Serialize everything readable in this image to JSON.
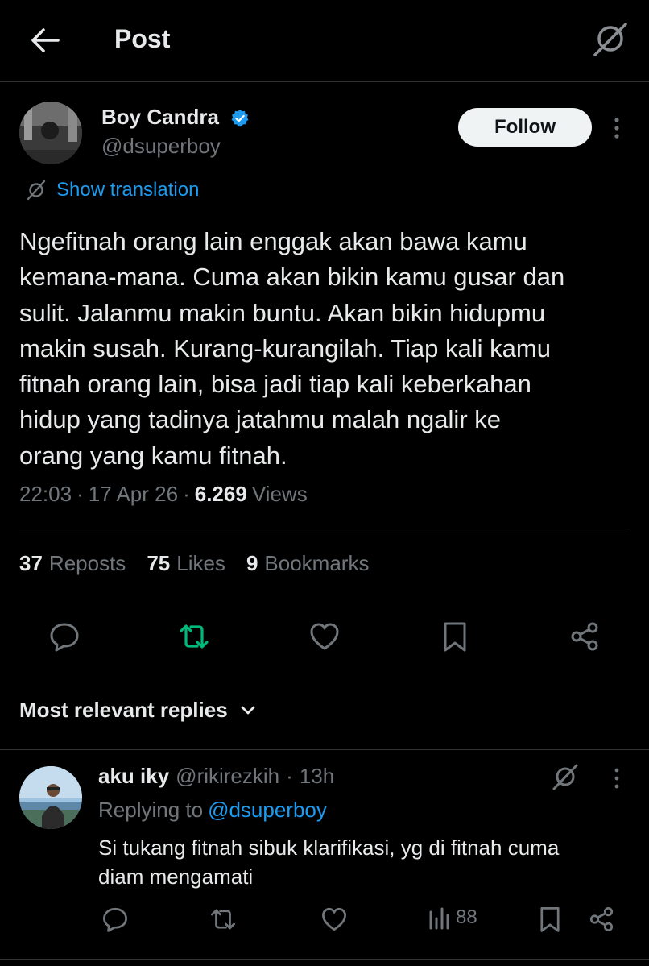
{
  "header": {
    "title": "Post"
  },
  "author": {
    "name": "Boy Candra",
    "handle": "@dsuperboy",
    "verified": true,
    "follow_label": "Follow"
  },
  "translation": {
    "label": "Show translation"
  },
  "post": {
    "text": "Ngefitnah orang lain enggak akan bawa kamu\nkemana-mana. Cuma akan bikin kamu gusar dan\nsulit. Jalanmu makin buntu. Akan bikin hidupmu\nmakin susah. Kurang-kurangilah. Tiap kali kamu\nfitnah orang lain, bisa jadi tiap kali keberkahan\nhidup yang tadinya jatahmu malah ngalir ke\norang yang kamu fitnah.",
    "time": "22:03",
    "date": "17 Apr 26",
    "views_count": "6.269",
    "views_label": "Views"
  },
  "stats": [
    {
      "count": "37",
      "label": "Reposts"
    },
    {
      "count": "75",
      "label": "Likes"
    },
    {
      "count": "9",
      "label": "Bookmarks"
    }
  ],
  "replies_sort": {
    "label": "Most relevant replies"
  },
  "reply": {
    "name": "aku iky",
    "handle": "@rikirezkih",
    "time": "13h",
    "replying_to_label": "Replying to",
    "replying_to_handle": "@dsuperboy",
    "text": "Si tukang fitnah sibuk klarifikasi, yg di fitnah cuma\ndiam mengamati",
    "views": "88"
  },
  "colors": {
    "background": "#000000",
    "text": "#e7e9ea",
    "muted": "#71767b",
    "link": "#1d9bf0",
    "repost_active": "#00ba7c",
    "divider": "#2f3336",
    "verified": "#1d9bf0"
  },
  "icons": [
    "back-arrow-icon",
    "grok-icon",
    "verified-badge-icon",
    "more-vertical-icon",
    "translate-icon",
    "reply-icon",
    "repost-icon",
    "like-icon",
    "bookmark-icon",
    "share-icon",
    "chevron-down-icon",
    "views-icon"
  ]
}
